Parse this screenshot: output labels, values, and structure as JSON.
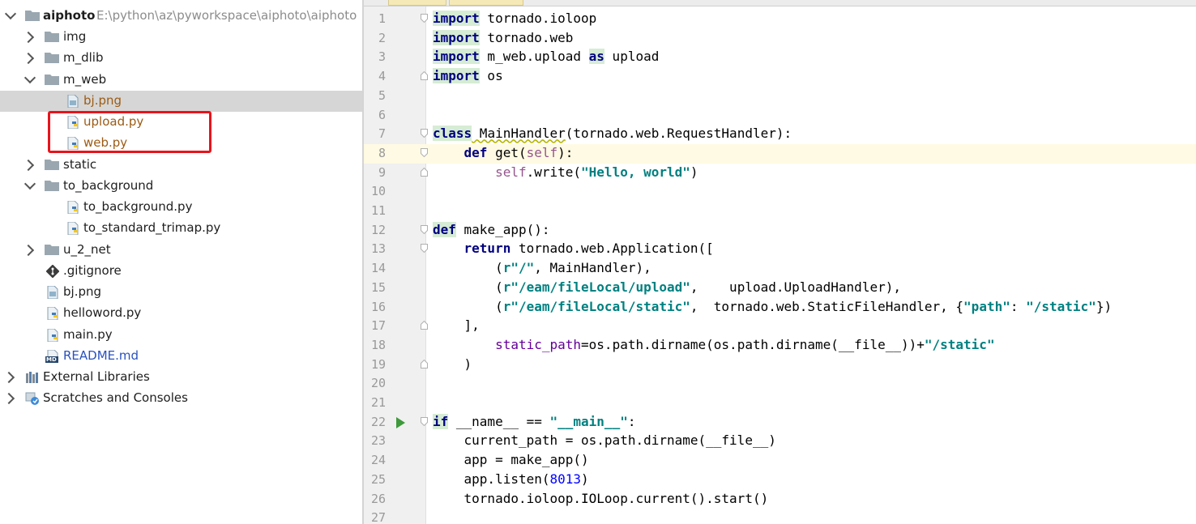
{
  "project_tree": {
    "root": {
      "name": "aiphoto",
      "path": "E:\\python\\az\\pyworkspace\\aiphoto\\aiphoto"
    },
    "items": [
      {
        "label": "img",
        "type": "folder"
      },
      {
        "label": "m_dlib",
        "type": "folder"
      },
      {
        "label": "m_web",
        "type": "folder"
      },
      {
        "label": "bj.png",
        "type": "image-file"
      },
      {
        "label": "upload.py",
        "type": "python-file"
      },
      {
        "label": "web.py",
        "type": "python-file"
      },
      {
        "label": "static",
        "type": "folder"
      },
      {
        "label": "to_background",
        "type": "folder"
      },
      {
        "label": "to_background.py",
        "type": "python-file"
      },
      {
        "label": "to_standard_trimap.py",
        "type": "python-file"
      },
      {
        "label": "u_2_net",
        "type": "folder"
      },
      {
        "label": ".gitignore",
        "type": "git-file"
      },
      {
        "label": "bj.png",
        "type": "image-file"
      },
      {
        "label": "helloword.py",
        "type": "python-file"
      },
      {
        "label": "main.py",
        "type": "python-file"
      },
      {
        "label": "README.md",
        "type": "markdown-file"
      },
      {
        "label": "External Libraries",
        "type": "libraries"
      },
      {
        "label": "Scratches and Consoles",
        "type": "scratches"
      }
    ],
    "md_badge": "MD"
  },
  "editor": {
    "line_numbers": [
      "1",
      "2",
      "3",
      "4",
      "5",
      "6",
      "7",
      "8",
      "9",
      "10",
      "11",
      "12",
      "13",
      "14",
      "15",
      "16",
      "17",
      "18",
      "19",
      "20",
      "21",
      "22",
      "23",
      "24",
      "25",
      "26",
      "27"
    ],
    "current_line": "8",
    "code": {
      "l1_kw": "import",
      "l1_rest": " tornado.ioloop",
      "l2_kw": "import",
      "l2_rest": " tornado.web",
      "l3_kw": "import",
      "l3_mid": " m_web.upload ",
      "l3_as": "as",
      "l3_rest": " upload",
      "l4_kw": "import",
      "l4_rest": " os",
      "l7_kw": "class",
      "l7_name": " MainHandler",
      "l7_rest": "(tornado.web.RequestHandler):",
      "l8_indent": "    ",
      "l8_kw": "def",
      "l8_a": " get(",
      "l8_self": "self",
      "l8_b": "):",
      "l9_indent": "        ",
      "l9_self": "self",
      "l9_a": ".write(",
      "l9_str": "\"Hello, world\"",
      "l9_b": ")",
      "l12_kw": "def",
      "l12_rest": " make_app():",
      "l13_indent": "    ",
      "l13_kw": "return",
      "l13_rest": " tornado.web.Application([",
      "l14_a": "        (",
      "l14_str": "r\"/\"",
      "l14_b": ", MainHandler),",
      "l15_a": "        (",
      "l15_str": "r\"/eam/fileLocal/upload\"",
      "l15_b": ",    upload.UploadHandler),",
      "l16_a": "        (",
      "l16_str": "r\"/eam/fileLocal/static\"",
      "l16_b": ",  tornado.web.StaticFileHandler, {",
      "l16_str2": "\"path\"",
      "l16_c": ": ",
      "l16_str3": "\"/static\"",
      "l16_d": "})",
      "l17": "    ],",
      "l18_indent": "        ",
      "l18_param": "static_path",
      "l18_a": "=os.path.dirname(os.path.dirname(__file__))+",
      "l18_str": "\"/static\"",
      "l19": "    )",
      "l22_kw": "if",
      "l22_a": " __name__ == ",
      "l22_str": "\"__main__\"",
      "l22_b": ":",
      "l23": "    current_path = os.path.dirname(__file__)",
      "l24": "    app = make_app()",
      "l25_a": "    app.listen(",
      "l25_num": "8013",
      "l25_b": ")",
      "l26": "    tornado.ioloop.IOLoop.current().start()"
    }
  },
  "colors": {
    "keyword": "#000080",
    "string": "#008080",
    "number": "#0000ff",
    "self": "#94558d",
    "param": "#660099",
    "highlight_box": "#e8141b",
    "current_line": "#fffae3",
    "run_arrow": "#3e9a3a"
  }
}
